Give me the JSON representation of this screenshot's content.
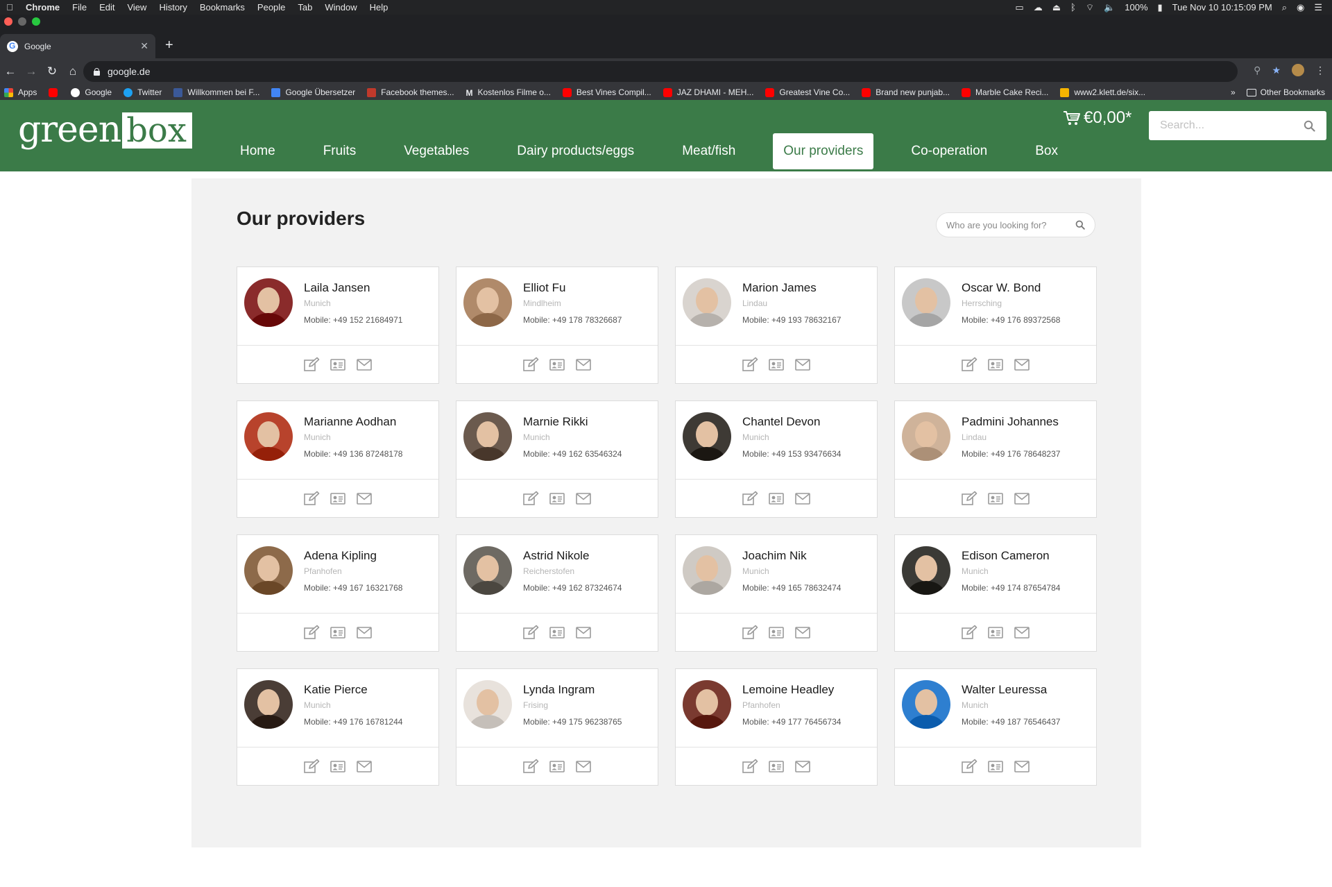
{
  "mac_menu": {
    "app": "Chrome",
    "items": [
      "File",
      "Edit",
      "View",
      "History",
      "Bookmarks",
      "People",
      "Tab",
      "Window",
      "Help"
    ],
    "battery": "100%",
    "datetime": "Tue Nov 10  10:15:09 PM"
  },
  "browser": {
    "tab_title": "Google",
    "url": "google.de",
    "bookmarks": [
      {
        "label": "Apps",
        "icon": "apps-icon"
      },
      {
        "label": "",
        "icon": "youtube-icon"
      },
      {
        "label": "Google",
        "icon": "google-icon"
      },
      {
        "label": "Twitter",
        "icon": "twitter-icon"
      },
      {
        "label": "Willkommen bei F...",
        "icon": "facebook-icon"
      },
      {
        "label": "Google Übersetzer",
        "icon": "translate-icon"
      },
      {
        "label": "Facebook themes...",
        "icon": "themes-icon"
      },
      {
        "label": "Kostenlos Filme o...",
        "icon": "m-icon"
      },
      {
        "label": "Best Vines Compil...",
        "icon": "youtube-icon"
      },
      {
        "label": "JAZ DHAMI - MEH...",
        "icon": "youtube-icon"
      },
      {
        "label": "Greatest Vine Co...",
        "icon": "youtube-icon"
      },
      {
        "label": "Brand new punjab...",
        "icon": "youtube-icon"
      },
      {
        "label": "Marble Cake Reci...",
        "icon": "youtube-icon"
      },
      {
        "label": "www2.klett.de/six...",
        "icon": "klett-icon"
      }
    ],
    "overflow": "»",
    "other_bookmarks": "Other Bookmarks"
  },
  "site": {
    "logo_green": "green",
    "logo_box": "box",
    "nav": [
      "Home",
      "Fruits",
      "Vegetables",
      "Dairy products/eggs",
      "Meat/fish",
      "Our providers",
      "Co-operation",
      "Box"
    ],
    "active_nav": "Our providers",
    "cart_total": "€0,00*",
    "search_placeholder": "Search..."
  },
  "page": {
    "title": "Our providers",
    "search_placeholder": "Who are you looking for?"
  },
  "providers": [
    {
      "name": "Laila Jansen",
      "city": "Munich",
      "mobile": "Mobile: +49 152 21684971"
    },
    {
      "name": "Elliot Fu",
      "city": "Mindlheim",
      "mobile": "Mobile: +49 178 78326687"
    },
    {
      "name": "Marion James",
      "city": "Lindau",
      "mobile": "Mobile: +49 193 78632167"
    },
    {
      "name": "Oscar W. Bond",
      "city": "Herrsching",
      "mobile": "Mobile: +49 176 89372568"
    },
    {
      "name": "Marianne Aodhan",
      "city": "Munich",
      "mobile": "Mobile: +49 136 87248178"
    },
    {
      "name": "Marnie Rikki",
      "city": "Munich",
      "mobile": "Mobile: +49 162 63546324"
    },
    {
      "name": "Chantel Devon",
      "city": "Munich",
      "mobile": "Mobile: +49 153 93476634"
    },
    {
      "name": "Padmini Johannes",
      "city": "Lindau",
      "mobile": "Mobile: +49 176 78648237"
    },
    {
      "name": "Adena Kipling",
      "city": "Pfanhofen",
      "mobile": "Mobile: +49 167 16321768"
    },
    {
      "name": "Astrid Nikole",
      "city": "Reicherstofen",
      "mobile": "Mobile: +49 162 87324674"
    },
    {
      "name": "Joachim Nik",
      "city": "Munich",
      "mobile": "Mobile: +49 165 78632474"
    },
    {
      "name": "Edison Cameron",
      "city": "Munich",
      "mobile": "Mobile: +49 174 87654784"
    },
    {
      "name": "Katie Pierce",
      "city": "Munich",
      "mobile": "Mobile: +49 176 16781244"
    },
    {
      "name": "Lynda Ingram",
      "city": "Frising",
      "mobile": "Mobile: +49 175 96238765"
    },
    {
      "name": "Lemoine Headley",
      "city": "Pfanhofen",
      "mobile": "Mobile: +49 177 76456734"
    },
    {
      "name": "Walter Leuressa",
      "city": "Munich",
      "mobile": "Mobile: +49 187 76546437"
    }
  ],
  "colors": {
    "brand_green": "#3b7b48",
    "content_bg": "#f2f2f2",
    "avatar_tones": [
      "#8a2b2b",
      "#b08a6a",
      "#d9d4cf",
      "#c8c8c8",
      "#b8432c",
      "#6b5a4e",
      "#3e3a35",
      "#cfb39a",
      "#8d6a4a",
      "#6e6a63",
      "#cfcac4",
      "#3b3a36",
      "#4a3d36",
      "#e8e2dc",
      "#7a3a30",
      "#2e7fd0"
    ]
  }
}
